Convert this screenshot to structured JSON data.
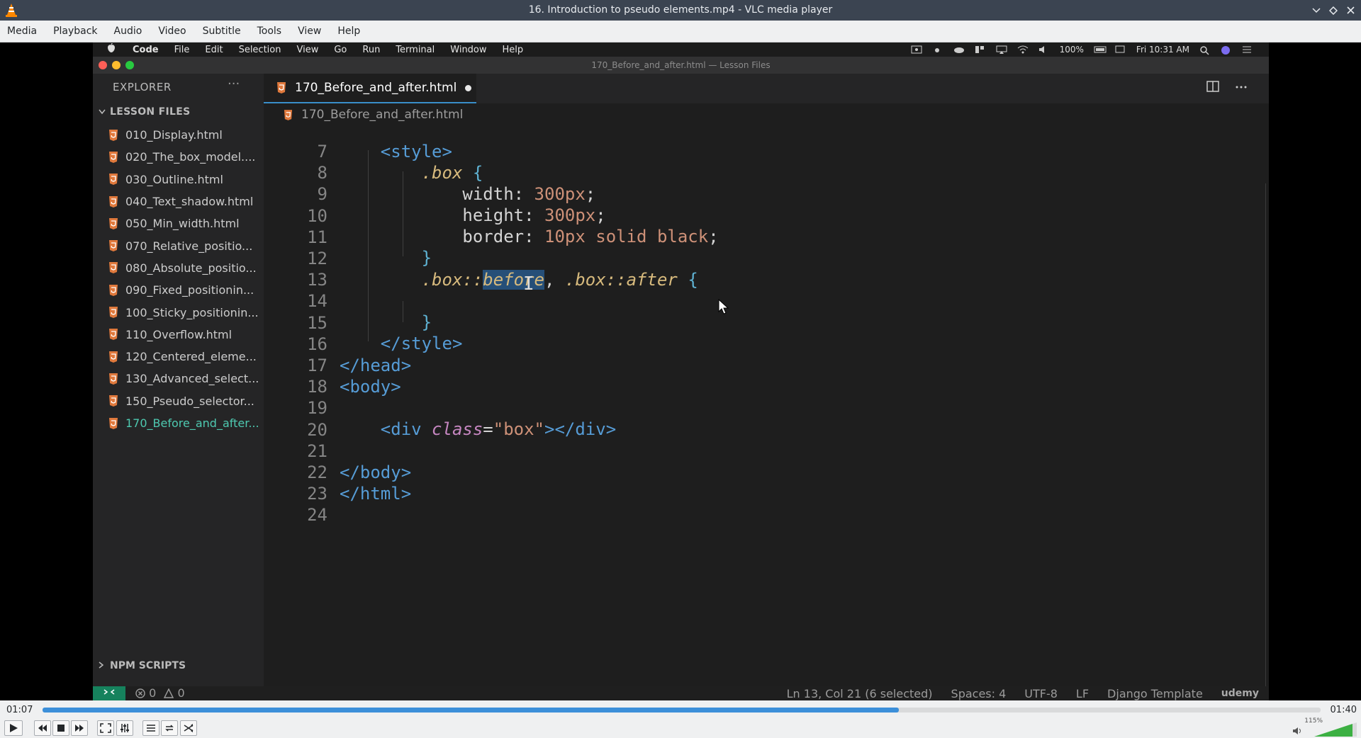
{
  "window": {
    "title": "16. Introduction to pseudo elements.mp4 - VLC media player",
    "controls": [
      "minimize",
      "restore",
      "close"
    ]
  },
  "menubar": [
    "Media",
    "Playback",
    "Audio",
    "Video",
    "Subtitle",
    "Tools",
    "View",
    "Help"
  ],
  "video": {
    "mac_menu": [
      "Code",
      "File",
      "Edit",
      "Selection",
      "View",
      "Go",
      "Run",
      "Terminal",
      "Window",
      "Help"
    ],
    "mac_status": {
      "battery": "100%",
      "clock": "Fri 10:31 AM"
    },
    "vscode_title": "170_Before_and_after.html — Lesson Files",
    "sidebar": {
      "header": "EXPLORER",
      "more": "···",
      "section": "LESSON FILES",
      "files": [
        "010_Display.html",
        "020_The_box_model....",
        "030_Outline.html",
        "040_Text_shadow.html",
        "050_Min_width.html",
        "070_Relative_positio...",
        "080_Absolute_positio...",
        "090_Fixed_positionin...",
        "100_Sticky_positionin...",
        "110_Overflow.html",
        "120_Centered_eleme...",
        "130_Advanced_select...",
        "150_Pseudo_selector...",
        "170_Before_and_after..."
      ],
      "active_index": 13,
      "npm_section": "NPM SCRIPTS"
    },
    "tab": {
      "name": "170_Before_and_after.html"
    },
    "breadcrumb": "170_Before_and_after.html",
    "line_numbers": [
      "7",
      "8",
      "9",
      "10",
      "11",
      "12",
      "13",
      "14",
      "15",
      "16",
      "17",
      "18",
      "19",
      "20",
      "21",
      "22",
      "23",
      "24"
    ],
    "status": {
      "problems": "0",
      "warnings": "0",
      "position": "Ln 13, Col 21 (6 selected)",
      "spaces": "Spaces: 4",
      "encoding": "UTF-8",
      "eol": "LF",
      "language": "Django Template",
      "brand": "udemy"
    }
  },
  "player": {
    "elapsed": "01:07",
    "total": "01:40",
    "progress_fraction": 0.67,
    "volume_pct": "115%",
    "volume_fraction": 0.9
  },
  "colors": {
    "accent": "#3c8fd9",
    "vscode_tab_border": "#3a8ec9",
    "remote_green": "#16825d"
  }
}
